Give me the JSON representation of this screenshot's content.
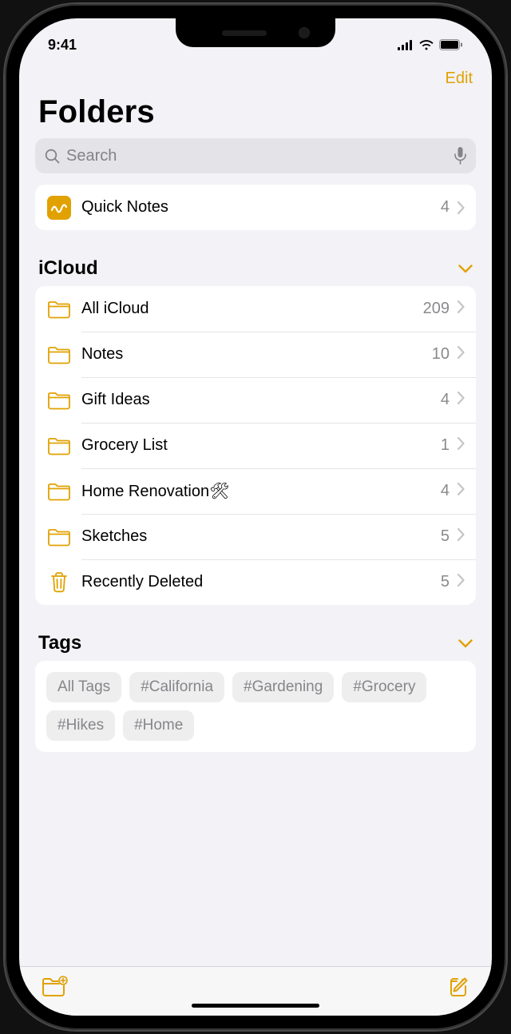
{
  "status": {
    "time": "9:41"
  },
  "nav": {
    "edit": "Edit"
  },
  "page_title": "Folders",
  "search": {
    "placeholder": "Search"
  },
  "quick_notes": {
    "label": "Quick Notes",
    "count": "4"
  },
  "sections": {
    "icloud": {
      "title": "iCloud",
      "folders": [
        {
          "label": "All iCloud",
          "count": "209",
          "icon": "folder"
        },
        {
          "label": "Notes",
          "count": "10",
          "icon": "folder"
        },
        {
          "label": "Gift Ideas",
          "count": "4",
          "icon": "folder"
        },
        {
          "label": "Grocery List",
          "count": "1",
          "icon": "folder"
        },
        {
          "label": "Home Renovation🛠",
          "count": "4",
          "icon": "folder"
        },
        {
          "label": "Sketches",
          "count": "5",
          "icon": "folder"
        },
        {
          "label": "Recently Deleted",
          "count": "5",
          "icon": "trash"
        }
      ]
    },
    "tags": {
      "title": "Tags",
      "items": [
        "All Tags",
        "#California",
        "#Gardening",
        "#Grocery",
        "#Hikes",
        "#Home"
      ]
    }
  },
  "colors": {
    "accent": "#e1a100"
  }
}
